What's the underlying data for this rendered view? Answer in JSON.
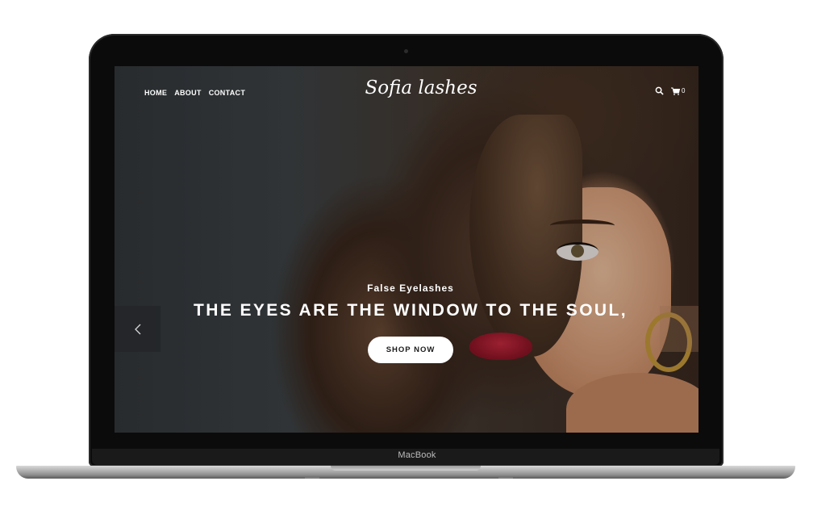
{
  "device": {
    "brand_label": "MacBook"
  },
  "site": {
    "nav": [
      {
        "label": "HOME"
      },
      {
        "label": "ABOUT"
      },
      {
        "label": "CONTACT"
      }
    ],
    "logo": "Sofia lashes",
    "cart_count": "0",
    "icons": [
      "search-icon",
      "cart-icon",
      "chevron-left-icon"
    ]
  },
  "hero": {
    "eyebrow": "False Eyelashes",
    "headline": "THE EYES ARE THE WINDOW TO THE SOUL,",
    "cta": "SHOP NOW"
  },
  "colors": {
    "text": "#ffffff",
    "button_bg": "#ffffff",
    "laptop_bezel": "#0b0b0b"
  }
}
